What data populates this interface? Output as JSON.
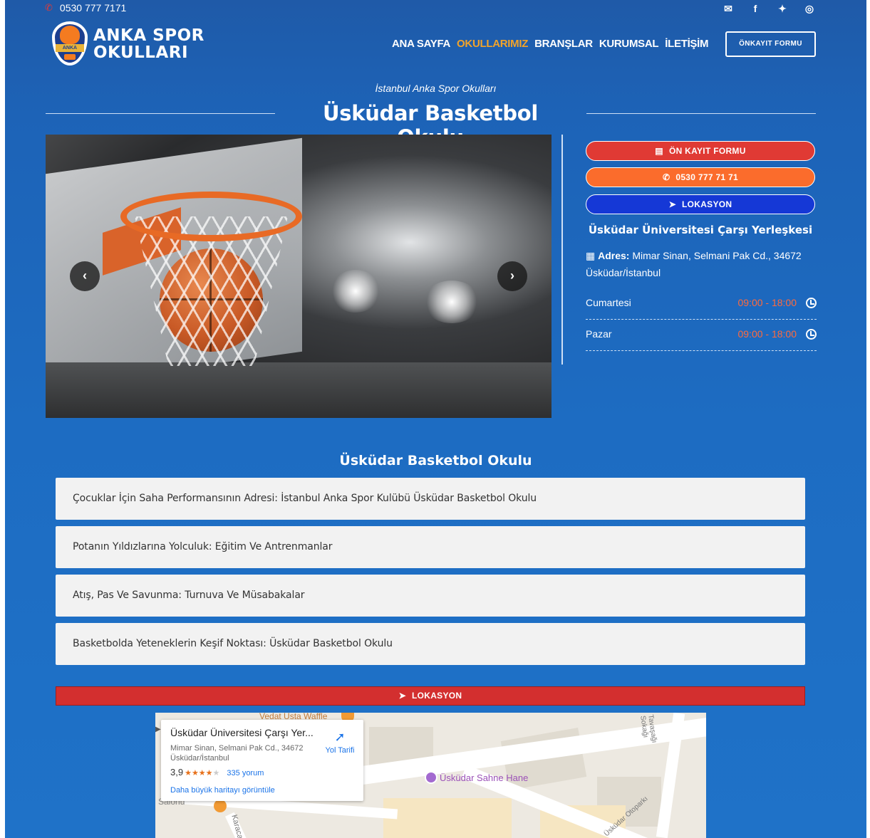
{
  "colors": {
    "page_bg_top": "#1f5aa8",
    "page_bg_bottom": "#1f72c8",
    "accent_orange": "#f2a42a",
    "btn_red": "#e03a34",
    "btn_orange": "#fb6c2c",
    "btn_blue": "#1538d6",
    "time_orange": "#ff6a3d"
  },
  "topbar": {
    "phone": "0530 777 7171",
    "phone_icon": "phone-icon",
    "socials": [
      "envelope-icon",
      "facebook-icon",
      "twitter-icon",
      "instagram-icon"
    ]
  },
  "logo": {
    "line1": "ANKA SPOR",
    "line2": "OKULLARI",
    "badge_text": "ANKA SPOR"
  },
  "nav": {
    "items": [
      "ANA SAYFA",
      "OKULLARIMIZ",
      "BRANŞLAR",
      "KURUMSAL",
      "İLETİŞİM"
    ],
    "active_index": 1,
    "cta": "ÖNKAYIT FORMU"
  },
  "hero": {
    "subtitle": "İstanbul Anka Spor Okulları",
    "title": "Üsküdar Basketbol Okulu"
  },
  "slider": {
    "prev": "‹",
    "next": "›"
  },
  "side": {
    "btn_register": "ÖN KAYIT FORMU",
    "btn_phone": "0530 777 71 71",
    "btn_location": "LOKASYON",
    "place_name": "Üsküdar Üniversitesi Çarşı Yerleşkesi",
    "address_label": "Adres:",
    "address_text": "Mimar Sinan, Selmani Pak Cd., 34672 Üsküdar/İstanbul",
    "hours": [
      {
        "day": "Cumartesi",
        "time": "09:00 - 18:00"
      },
      {
        "day": "Pazar",
        "time": "09:00 - 18:00"
      }
    ]
  },
  "content": {
    "section_title": "Üsküdar Basketbol Okulu",
    "accordion": [
      "Çocuklar İçin Saha Performansının Adresi: İstanbul Anka Spor Kulübü Üsküdar Basketbol Okulu",
      "Potanın Yıldızlarına Yolculuk: Eğitim Ve Antrenmanlar",
      "Atış, Pas Ve Savunma: Turnuva Ve Müsabakalar",
      "Basketbolda Yeteneklerin Keşif Noktası: Üsküdar Basketbol Okulu"
    ],
    "location_bar": "LOKASYON"
  },
  "map": {
    "card_name": "Üsküdar Üniversitesi Çarşı Yer...",
    "card_address": "Mimar Sinan, Selmani Pak Cd., 34672 Üsküdar/İstanbul",
    "rating": "3,9",
    "rating_value": 3.9,
    "reviews": "335 yorum",
    "bigger_map": "Daha büyük haritayı görüntüle",
    "directions": "Yol Tarifi",
    "poi_label": "Üsküdar Sahne Hane",
    "top_label": "Vedat Usta Waffle",
    "left_label": "Salonu",
    "street_1": "Karaca",
    "street_2": "Tavaşağı Sokağı",
    "street_3": "Üsküdar Otoparkı"
  }
}
